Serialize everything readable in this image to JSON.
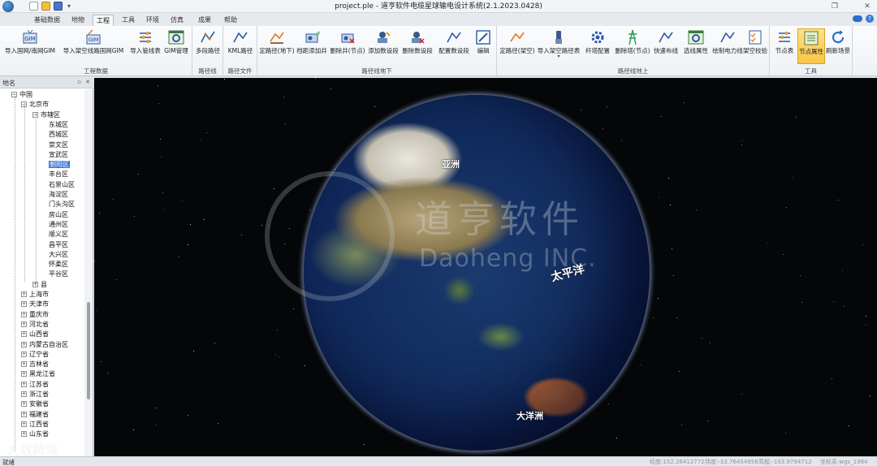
{
  "window": {
    "title": "project.ple - 道亨软件电缆星球输电设计系统(2.1.2023.0428)",
    "restore_glyph": "❐",
    "close_glyph": "✕",
    "quick_access_more": "▾"
  },
  "menu": {
    "tabs": [
      "基础数据",
      "地物",
      "工程",
      "工具",
      "环境",
      "仿真",
      "成果",
      "帮助"
    ],
    "active": "工程",
    "help_glyph": "?"
  },
  "ribbon": {
    "groups": [
      {
        "label": "工程数据",
        "buttons": [
          "导入国网/南网GIM",
          "导入架空线路国网GIM",
          "导入管线表",
          "GIM管理"
        ]
      },
      {
        "label": "路径线",
        "buttons": [
          "多段路径"
        ]
      },
      {
        "label": "路径文件",
        "buttons": [
          "KML路径"
        ]
      },
      {
        "label": "路径线地下",
        "buttons": [
          "定路径(地下)",
          "档距添加井",
          "删除井(节点)",
          "添加数设段",
          "删除数设段",
          "配置数设段",
          "编辑"
        ]
      },
      {
        "label": "路径线地上",
        "buttons": [
          "定路径(架空)",
          "导入架空路径表",
          "杆塔配置",
          "删除塔(节点)",
          "快速布线",
          "选线属性",
          "绘制电力线",
          "架空校验"
        ]
      },
      {
        "label": "工具",
        "buttons": [
          "节点表",
          "节点属性",
          "刷新场景"
        ]
      }
    ],
    "active_button": "节点属性",
    "dropdown_glyph": "▾"
  },
  "left_pane": {
    "title": "地名",
    "pin_glyph": "▫",
    "close_glyph": "✕",
    "tree": [
      {
        "label": "中国",
        "level": 0,
        "expander": "−"
      },
      {
        "label": "北京市",
        "level": 1,
        "expander": "−"
      },
      {
        "label": "市辖区",
        "level": 2,
        "expander": "−"
      },
      {
        "label": "东城区",
        "level": 3
      },
      {
        "label": "西城区",
        "level": 3
      },
      {
        "label": "崇文区",
        "level": 3
      },
      {
        "label": "宣武区",
        "level": 3
      },
      {
        "label": "朝阳区",
        "level": 3,
        "selected": true
      },
      {
        "label": "丰台区",
        "level": 3
      },
      {
        "label": "石景山区",
        "level": 3
      },
      {
        "label": "海淀区",
        "level": 3
      },
      {
        "label": "门头沟区",
        "level": 3
      },
      {
        "label": "房山区",
        "level": 3
      },
      {
        "label": "通州区",
        "level": 3
      },
      {
        "label": "顺义区",
        "level": 3
      },
      {
        "label": "昌平区",
        "level": 3
      },
      {
        "label": "大兴区",
        "level": 3
      },
      {
        "label": "怀柔区",
        "level": 3
      },
      {
        "label": "平谷区",
        "level": 3
      },
      {
        "label": "县",
        "level": 2,
        "expander": "+"
      },
      {
        "label": "上海市",
        "level": 1,
        "expander": "+"
      },
      {
        "label": "天津市",
        "level": 1,
        "expander": "+"
      },
      {
        "label": "重庆市",
        "level": 1,
        "expander": "+"
      },
      {
        "label": "河北省",
        "level": 1,
        "expander": "+"
      },
      {
        "label": "山西省",
        "level": 1,
        "expander": "+"
      },
      {
        "label": "内蒙古自治区",
        "level": 1,
        "expander": "+"
      },
      {
        "label": "辽宁省",
        "level": 1,
        "expander": "+"
      },
      {
        "label": "吉林省",
        "level": 1,
        "expander": "+"
      },
      {
        "label": "黑龙江省",
        "level": 1,
        "expander": "+"
      },
      {
        "label": "江苏省",
        "level": 1,
        "expander": "+"
      },
      {
        "label": "浙江省",
        "level": 1,
        "expander": "+"
      },
      {
        "label": "安徽省",
        "level": 1,
        "expander": "+"
      },
      {
        "label": "福建省",
        "level": 1,
        "expander": "+"
      },
      {
        "label": "江西省",
        "level": 1,
        "expander": "+"
      },
      {
        "label": "山东省",
        "level": 1,
        "expander": "+"
      }
    ]
  },
  "globe": {
    "labels": [
      "亚洲",
      "太平洋",
      "大洋洲"
    ],
    "watermark_cn": "道亨软件",
    "watermark_en": "Daoheng INC."
  },
  "brand_watermark": "大数跨境",
  "statusbar": {
    "status": "就绪",
    "items": [
      "经度:152.26412772",
      "纬度:-33.76454958",
      "高程:-103.9794712",
      "坐标系:wgs_1984"
    ]
  },
  "colors": {
    "accent": "#3875d7",
    "active_button": "#f9c446",
    "space": "#050608"
  }
}
